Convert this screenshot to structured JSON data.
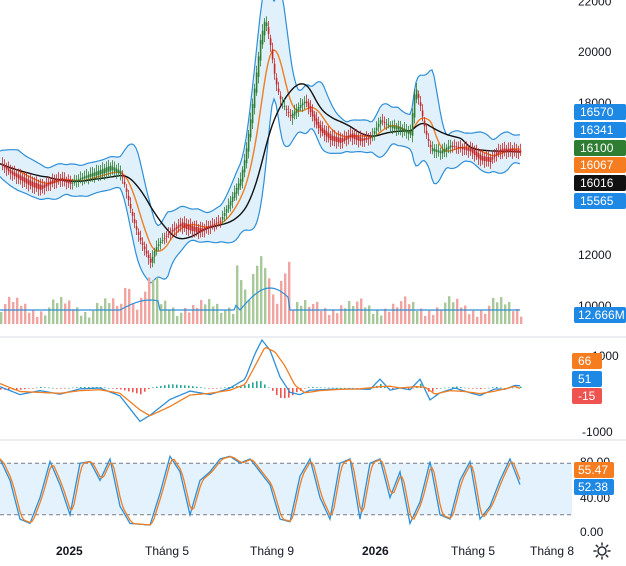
{
  "chart_data": [
    {
      "type": "candlestick",
      "panel": "price",
      "title": "",
      "y_axis_ticks": [
        10000,
        12000,
        14000,
        16000,
        18000,
        20000,
        22000
      ],
      "y_axis_labels": [
        "10000",
        "12000",
        "",
        "",
        "18000",
        "20000",
        "22000"
      ],
      "ylim": [
        9250,
        22050
      ],
      "price_series": [
        [
          0,
          15600
        ],
        [
          10,
          15300
        ],
        [
          20,
          15100
        ],
        [
          30,
          14900
        ],
        [
          40,
          14750
        ],
        [
          50,
          14950
        ],
        [
          60,
          15050
        ],
        [
          70,
          14850
        ],
        [
          80,
          15000
        ],
        [
          90,
          15100
        ],
        [
          100,
          15200
        ],
        [
          110,
          15350
        ],
        [
          120,
          15150
        ],
        [
          125,
          14500
        ],
        [
          130,
          13700
        ],
        [
          135,
          13000
        ],
        [
          140,
          12500
        ],
        [
          145,
          12100
        ],
        [
          150,
          11700
        ],
        [
          155,
          12300
        ],
        [
          160,
          12600
        ],
        [
          170,
          13000
        ],
        [
          180,
          13300
        ],
        [
          190,
          13150
        ],
        [
          200,
          13050
        ],
        [
          210,
          13200
        ],
        [
          220,
          13400
        ],
        [
          230,
          14100
        ],
        [
          240,
          14900
        ],
        [
          245,
          15800
        ],
        [
          250,
          17200
        ],
        [
          255,
          18700
        ],
        [
          260,
          20300
        ],
        [
          265,
          21200
        ],
        [
          270,
          20100
        ],
        [
          275,
          18700
        ],
        [
          280,
          18000
        ],
        [
          285,
          17700
        ],
        [
          290,
          17400
        ],
        [
          300,
          17900
        ],
        [
          305,
          18100
        ],
        [
          310,
          17700
        ],
        [
          315,
          17300
        ],
        [
          320,
          17000
        ],
        [
          330,
          16700
        ],
        [
          340,
          16600
        ],
        [
          350,
          16800
        ],
        [
          360,
          16600
        ],
        [
          370,
          16650
        ],
        [
          380,
          17300
        ],
        [
          390,
          17000
        ],
        [
          400,
          16900
        ],
        [
          410,
          16700
        ],
        [
          415,
          18500
        ],
        [
          420,
          17700
        ],
        [
          425,
          16700
        ],
        [
          430,
          16100
        ],
        [
          440,
          16000
        ],
        [
          450,
          16300
        ],
        [
          460,
          16250
        ],
        [
          470,
          16200
        ],
        [
          480,
          15900
        ],
        [
          490,
          15850
        ],
        [
          495,
          16100
        ],
        [
          500,
          16200
        ],
        [
          510,
          16200
        ],
        [
          520,
          16100
        ]
      ],
      "bollinger": {
        "color": "#2e8fd8",
        "fill": "#dbeefb",
        "period_label": ""
      },
      "moving_averages": [
        {
          "color": "#f07d22",
          "period_label": ""
        },
        {
          "color": "#111111",
          "period_label": ""
        }
      ],
      "volume_bar_colors": {
        "up": "#a7c99a",
        "down": "#f2a4a0"
      },
      "volume_avg_color": "#2e8fd8",
      "price_badges": [
        {
          "text": "16570",
          "bg": "#1e88e5",
          "fg": "#ffffff",
          "value": 16570
        },
        {
          "text": "16341",
          "bg": "#1e88e5",
          "fg": "#ffffff",
          "value": 16341
        },
        {
          "text": "16100",
          "bg": "#2e7d32",
          "fg": "#ffffff",
          "value": 16100
        },
        {
          "text": "16067",
          "bg": "#f57c1f",
          "fg": "#ffffff",
          "value": 16067
        },
        {
          "text": "16016",
          "bg": "#111111",
          "fg": "#ffffff",
          "value": 16016
        },
        {
          "text": "15565",
          "bg": "#1e88e5",
          "fg": "#ffffff",
          "value": 15565
        }
      ],
      "volume_badge": {
        "text": "12.666M",
        "bg": "#1e88e5",
        "fg": "#ffffff"
      }
    },
    {
      "type": "macd",
      "panel": "macd",
      "title": "",
      "y_axis_labels": [
        "1000",
        "-1000"
      ],
      "ylim": [
        -1000,
        1000
      ],
      "macd_color": "#2e8fd8",
      "signal_color": "#f07d22",
      "hist_colors": {
        "pos": "#26a69a",
        "neg": "#ef5350"
      },
      "macd_series": [
        [
          0,
          30
        ],
        [
          20,
          -150
        ],
        [
          40,
          -60
        ],
        [
          60,
          -140
        ],
        [
          80,
          -20
        ],
        [
          100,
          0
        ],
        [
          120,
          -180
        ],
        [
          140,
          -760
        ],
        [
          150,
          -620
        ],
        [
          170,
          -260
        ],
        [
          190,
          -70
        ],
        [
          210,
          -150
        ],
        [
          230,
          0
        ],
        [
          245,
          200
        ],
        [
          255,
          780
        ],
        [
          262,
          1090
        ],
        [
          270,
          860
        ],
        [
          280,
          250
        ],
        [
          290,
          -100
        ],
        [
          300,
          -150
        ],
        [
          310,
          -50
        ],
        [
          330,
          -30
        ],
        [
          350,
          -20
        ],
        [
          370,
          -30
        ],
        [
          380,
          200
        ],
        [
          390,
          -50
        ],
        [
          400,
          0
        ],
        [
          410,
          -40
        ],
        [
          420,
          200
        ],
        [
          430,
          -270
        ],
        [
          440,
          -110
        ],
        [
          455,
          0
        ],
        [
          470,
          -110
        ],
        [
          480,
          -170
        ],
        [
          495,
          -20
        ],
        [
          505,
          -30
        ],
        [
          515,
          60
        ],
        [
          520,
          50
        ]
      ],
      "signal_series": [
        [
          0,
          100
        ],
        [
          20,
          -80
        ],
        [
          40,
          -100
        ],
        [
          60,
          -120
        ],
        [
          80,
          -60
        ],
        [
          100,
          -40
        ],
        [
          120,
          -120
        ],
        [
          140,
          -500
        ],
        [
          150,
          -630
        ],
        [
          170,
          -420
        ],
        [
          190,
          -160
        ],
        [
          210,
          -120
        ],
        [
          230,
          -50
        ],
        [
          245,
          80
        ],
        [
          255,
          500
        ],
        [
          265,
          930
        ],
        [
          275,
          820
        ],
        [
          285,
          500
        ],
        [
          295,
          60
        ],
        [
          305,
          -110
        ],
        [
          320,
          -60
        ],
        [
          340,
          -30
        ],
        [
          360,
          -20
        ],
        [
          380,
          30
        ],
        [
          390,
          40
        ],
        [
          400,
          0
        ],
        [
          415,
          30
        ],
        [
          425,
          20
        ],
        [
          435,
          -140
        ],
        [
          450,
          -60
        ],
        [
          465,
          -80
        ],
        [
          480,
          -130
        ],
        [
          495,
          -70
        ],
        [
          505,
          -20
        ],
        [
          515,
          40
        ],
        [
          520,
          -10
        ]
      ],
      "badges": [
        {
          "text": "66",
          "bg": "#f57c1f",
          "fg": "#ffffff",
          "value": 66
        },
        {
          "text": "51",
          "bg": "#1e88e5",
          "fg": "#ffffff",
          "value": 51
        },
        {
          "text": "-15",
          "bg": "#ef5350",
          "fg": "#ffffff",
          "value": -15
        }
      ]
    },
    {
      "type": "stochastic",
      "panel": "stoch",
      "title": "",
      "y_axis_labels": [
        "80.00",
        "40.00",
        "0.00"
      ],
      "ylim": [
        0,
        100
      ],
      "bands": [
        80,
        20
      ],
      "band_fill": "#e3f2fd",
      "k_color": "#2e8fd8",
      "d_color": "#f07d22",
      "series": [
        [
          0,
          85
        ],
        [
          10,
          60
        ],
        [
          20,
          15
        ],
        [
          30,
          10
        ],
        [
          40,
          40
        ],
        [
          50,
          82
        ],
        [
          60,
          55
        ],
        [
          70,
          20
        ],
        [
          80,
          80
        ],
        [
          90,
          82
        ],
        [
          100,
          60
        ],
        [
          110,
          85
        ],
        [
          120,
          30
        ],
        [
          130,
          10
        ],
        [
          150,
          8
        ],
        [
          160,
          45
        ],
        [
          170,
          88
        ],
        [
          180,
          70
        ],
        [
          190,
          20
        ],
        [
          200,
          60
        ],
        [
          210,
          70
        ],
        [
          220,
          85
        ],
        [
          230,
          88
        ],
        [
          240,
          80
        ],
        [
          250,
          85
        ],
        [
          260,
          70
        ],
        [
          270,
          55
        ],
        [
          280,
          15
        ],
        [
          290,
          12
        ],
        [
          300,
          65
        ],
        [
          310,
          85
        ],
        [
          320,
          40
        ],
        [
          330,
          15
        ],
        [
          340,
          80
        ],
        [
          350,
          85
        ],
        [
          360,
          15
        ],
        [
          370,
          80
        ],
        [
          380,
          85
        ],
        [
          390,
          40
        ],
        [
          400,
          70
        ],
        [
          410,
          10
        ],
        [
          420,
          35
        ],
        [
          430,
          82
        ],
        [
          440,
          20
        ],
        [
          450,
          15
        ],
        [
          460,
          60
        ],
        [
          470,
          82
        ],
        [
          480,
          15
        ],
        [
          490,
          30
        ],
        [
          500,
          60
        ],
        [
          510,
          85
        ],
        [
          520,
          55
        ]
      ],
      "badges": [
        {
          "text": "55.47",
          "bg": "#f57c1f",
          "fg": "#ffffff",
          "value": 55.47
        },
        {
          "text": "52.38",
          "bg": "#1e88e5",
          "fg": "#ffffff",
          "value": 52.38
        }
      ]
    }
  ],
  "x_axis_labels": [
    "2025",
    "Tháng 5",
    "Tháng 9",
    "2026",
    "Tháng 5",
    "Tháng 8"
  ],
  "x_axis_bold": [
    true,
    false,
    false,
    true,
    false,
    false
  ],
  "settings_icon": "gear-icon"
}
